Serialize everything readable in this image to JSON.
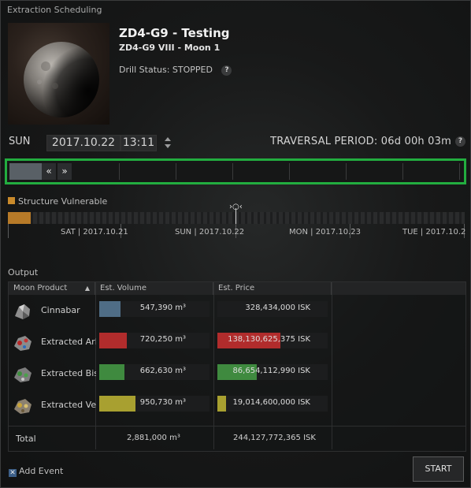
{
  "window": {
    "title": "Extraction Scheduling"
  },
  "structure": {
    "name": "ZD4-G9 - Testing",
    "moon": "ZD4-G9 VIII - Moon 1",
    "drill_status": "Drill Status: STOPPED",
    "help": "?"
  },
  "schedule": {
    "day": "SUN",
    "date": "2017.10.22",
    "time": "13:11",
    "traversal": "TRAVERSAL PERIOD: 06d 00h 03m",
    "help": "?"
  },
  "timeline": {
    "back_label": "«",
    "forward_label": "»",
    "selected_fraction": 0.07
  },
  "vulnerability": {
    "legend": "Structure Vulnerable",
    "color": "#c98a2b",
    "days": [
      "SAT | 2017.10.21",
      "SUN | 2017.10.22",
      "MON | 2017.10.23",
      "TUE | 2017.10.2"
    ]
  },
  "output": {
    "label": "Output",
    "headers": {
      "product": "Moon Product",
      "volume": "Est. Volume",
      "price": "Est. Price"
    },
    "rows": [
      {
        "name": "Cinnabar",
        "volume": "547,390 m³",
        "price": "328,434,000 ISK",
        "color": "#4f6d86",
        "vol_fraction": 0.19,
        "price_fraction": 0.0
      },
      {
        "name": "Extracted Ark",
        "volume": "720,250 m³",
        "price": "138,130,625,375 ISK",
        "color": "#b12c2c",
        "vol_fraction": 0.25,
        "price_fraction": 0.57
      },
      {
        "name": "Extracted Bis",
        "volume": "662,630 m³",
        "price": "86,654,112,990 ISK",
        "color": "#3f8a3f",
        "vol_fraction": 0.23,
        "price_fraction": 0.36
      },
      {
        "name": "Extracted Vel",
        "volume": "950,730 m³",
        "price": "19,014,600,000 ISK",
        "color": "#a8a030",
        "vol_fraction": 0.33,
        "price_fraction": 0.08
      }
    ],
    "total": {
      "label": "Total",
      "volume": "2,881,000 m³",
      "price": "244,127,772,365 ISK"
    }
  },
  "footer": {
    "add_event": "Add Event",
    "add_event_checked": true,
    "start": "START"
  }
}
